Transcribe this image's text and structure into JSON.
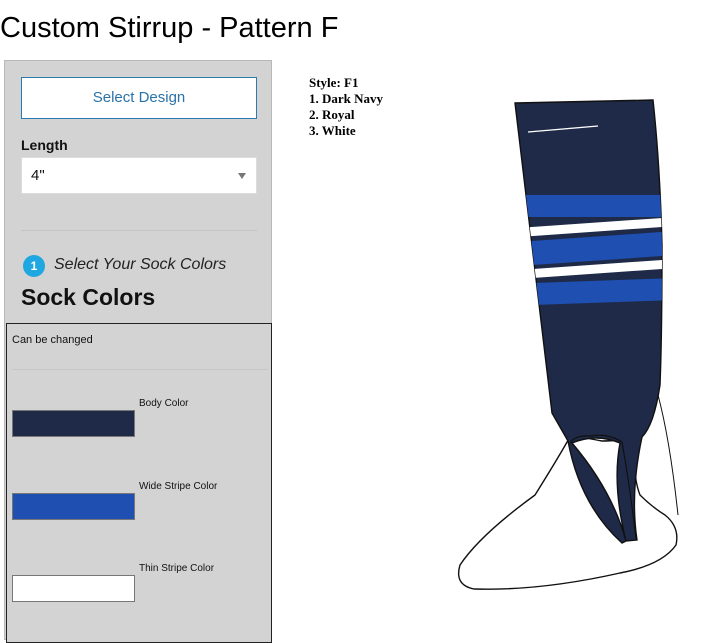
{
  "page": {
    "title": "Custom Stirrup - Pattern F"
  },
  "panel": {
    "select_design_label": "Select Design",
    "length": {
      "label": "Length",
      "value": "4\""
    },
    "step": {
      "number": "1",
      "text": "Select Your Sock Colors"
    },
    "heading": "Sock Colors",
    "colors_box": {
      "note": "Can be changed",
      "items": [
        {
          "label": "Body Color",
          "color": "#1e2a47"
        },
        {
          "label": "Wide Stripe Color",
          "color": "#1f4fb0"
        },
        {
          "label": "Thin Stripe Color",
          "color": "#ffffff"
        }
      ]
    }
  },
  "style_info": {
    "style": "Style: F1",
    "colors": [
      "1. Dark Navy",
      "2. Royal",
      "3. White"
    ]
  },
  "sock": {
    "body_color": "#1e2a47",
    "wide_stripe_color": "#1f4fb0",
    "thin_stripe_color": "#ffffff"
  }
}
